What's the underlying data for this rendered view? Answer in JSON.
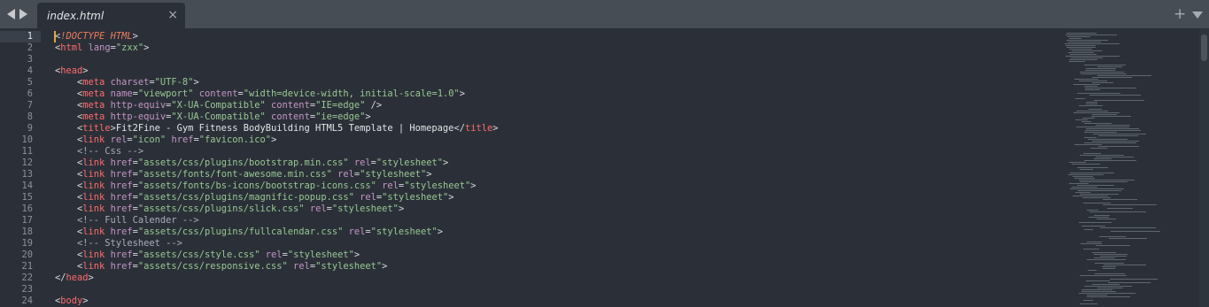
{
  "tabbar": {
    "tab_title": "index.html",
    "close_glyph": "×",
    "plus_glyph": "+"
  },
  "editor": {
    "current_line": 1,
    "lines": [
      {
        "num": "1",
        "tokens": [
          [
            "pn",
            "<"
          ],
          [
            "dt",
            "!DOCTYPE HTML"
          ],
          [
            "pn",
            ">"
          ]
        ]
      },
      {
        "num": "2",
        "tokens": [
          [
            "pn",
            "<"
          ],
          [
            "tg",
            "html"
          ],
          [
            "pn",
            " "
          ],
          [
            "at",
            "lang"
          ],
          [
            "pn",
            "="
          ],
          [
            "st",
            "\"zxx\""
          ],
          [
            "pn",
            ">"
          ]
        ]
      },
      {
        "num": "3",
        "tokens": []
      },
      {
        "num": "4",
        "tokens": [
          [
            "pn",
            "<"
          ],
          [
            "tg",
            "head"
          ],
          [
            "pn",
            ">"
          ]
        ]
      },
      {
        "num": "5",
        "tokens": [
          [
            "pn",
            "    <"
          ],
          [
            "tg",
            "meta"
          ],
          [
            "pn",
            " "
          ],
          [
            "at",
            "charset"
          ],
          [
            "pn",
            "="
          ],
          [
            "st",
            "\"UTF-8\""
          ],
          [
            "pn",
            ">"
          ]
        ]
      },
      {
        "num": "6",
        "tokens": [
          [
            "pn",
            "    <"
          ],
          [
            "tg",
            "meta"
          ],
          [
            "pn",
            " "
          ],
          [
            "at",
            "name"
          ],
          [
            "pn",
            "="
          ],
          [
            "st",
            "\"viewport\""
          ],
          [
            "pn",
            " "
          ],
          [
            "at",
            "content"
          ],
          [
            "pn",
            "="
          ],
          [
            "st",
            "\"width=device-width, initial-scale=1.0\""
          ],
          [
            "pn",
            ">"
          ]
        ]
      },
      {
        "num": "7",
        "tokens": [
          [
            "pn",
            "    <"
          ],
          [
            "tg",
            "meta"
          ],
          [
            "pn",
            " "
          ],
          [
            "at",
            "http-equiv"
          ],
          [
            "pn",
            "="
          ],
          [
            "st",
            "\"X-UA-Compatible\""
          ],
          [
            "pn",
            " "
          ],
          [
            "at",
            "content"
          ],
          [
            "pn",
            "="
          ],
          [
            "st",
            "\"IE=edge\""
          ],
          [
            "pn",
            " />"
          ]
        ]
      },
      {
        "num": "8",
        "tokens": [
          [
            "pn",
            "    <"
          ],
          [
            "tg",
            "meta"
          ],
          [
            "pn",
            " "
          ],
          [
            "at",
            "http-equiv"
          ],
          [
            "pn",
            "="
          ],
          [
            "st",
            "\"X-UA-Compatible\""
          ],
          [
            "pn",
            " "
          ],
          [
            "at",
            "content"
          ],
          [
            "pn",
            "="
          ],
          [
            "st",
            "\"ie=edge\""
          ],
          [
            "pn",
            ">"
          ]
        ]
      },
      {
        "num": "9",
        "tokens": [
          [
            "pn",
            "    <"
          ],
          [
            "tg",
            "title"
          ],
          [
            "pn",
            ">"
          ],
          [
            "tx",
            "Fit2Fine - Gym Fitness BodyBuilding HTML5 Template | Homepage"
          ],
          [
            "pn",
            "</"
          ],
          [
            "tg",
            "title"
          ],
          [
            "pn",
            ">"
          ]
        ]
      },
      {
        "num": "10",
        "tokens": [
          [
            "pn",
            "    <"
          ],
          [
            "tg",
            "link"
          ],
          [
            "pn",
            " "
          ],
          [
            "at",
            "rel"
          ],
          [
            "pn",
            "="
          ],
          [
            "st",
            "\"icon\""
          ],
          [
            "pn",
            " "
          ],
          [
            "at",
            "href"
          ],
          [
            "pn",
            "="
          ],
          [
            "st",
            "\"favicon.ico\""
          ],
          [
            "pn",
            ">"
          ]
        ]
      },
      {
        "num": "11",
        "tokens": [
          [
            "cm",
            "    <!-- Css -->"
          ]
        ]
      },
      {
        "num": "12",
        "tokens": [
          [
            "pn",
            "    <"
          ],
          [
            "tg",
            "link"
          ],
          [
            "pn",
            " "
          ],
          [
            "at",
            "href"
          ],
          [
            "pn",
            "="
          ],
          [
            "st",
            "\"assets/css/plugins/bootstrap.min.css\""
          ],
          [
            "pn",
            " "
          ],
          [
            "at",
            "rel"
          ],
          [
            "pn",
            "="
          ],
          [
            "st",
            "\"stylesheet\""
          ],
          [
            "pn",
            ">"
          ]
        ]
      },
      {
        "num": "13",
        "tokens": [
          [
            "pn",
            "    <"
          ],
          [
            "tg",
            "link"
          ],
          [
            "pn",
            " "
          ],
          [
            "at",
            "href"
          ],
          [
            "pn",
            "="
          ],
          [
            "st",
            "\"assets/fonts/font-awesome.min.css\""
          ],
          [
            "pn",
            " "
          ],
          [
            "at",
            "rel"
          ],
          [
            "pn",
            "="
          ],
          [
            "st",
            "\"stylesheet\""
          ],
          [
            "pn",
            ">"
          ]
        ]
      },
      {
        "num": "14",
        "tokens": [
          [
            "pn",
            "    <"
          ],
          [
            "tg",
            "link"
          ],
          [
            "pn",
            " "
          ],
          [
            "at",
            "href"
          ],
          [
            "pn",
            "="
          ],
          [
            "st",
            "\"assets/fonts/bs-icons/bootstrap-icons.css\""
          ],
          [
            "pn",
            " "
          ],
          [
            "at",
            "rel"
          ],
          [
            "pn",
            "="
          ],
          [
            "st",
            "\"stylesheet\""
          ],
          [
            "pn",
            ">"
          ]
        ]
      },
      {
        "num": "15",
        "tokens": [
          [
            "pn",
            "    <"
          ],
          [
            "tg",
            "link"
          ],
          [
            "pn",
            " "
          ],
          [
            "at",
            "href"
          ],
          [
            "pn",
            "="
          ],
          [
            "st",
            "\"assets/css/plugins/magnific-popup.css\""
          ],
          [
            "pn",
            " "
          ],
          [
            "at",
            "rel"
          ],
          [
            "pn",
            "="
          ],
          [
            "st",
            "\"stylesheet\""
          ],
          [
            "pn",
            ">"
          ]
        ]
      },
      {
        "num": "16",
        "tokens": [
          [
            "pn",
            "    <"
          ],
          [
            "tg",
            "link"
          ],
          [
            "pn",
            " "
          ],
          [
            "at",
            "href"
          ],
          [
            "pn",
            "="
          ],
          [
            "st",
            "\"assets/css/plugins/slick.css\""
          ],
          [
            "pn",
            " "
          ],
          [
            "at",
            "rel"
          ],
          [
            "pn",
            "="
          ],
          [
            "st",
            "\"stylesheet\""
          ],
          [
            "pn",
            ">"
          ]
        ]
      },
      {
        "num": "17",
        "tokens": [
          [
            "cm",
            "    <!-- Full Calender -->"
          ]
        ]
      },
      {
        "num": "18",
        "tokens": [
          [
            "pn",
            "    <"
          ],
          [
            "tg",
            "link"
          ],
          [
            "pn",
            " "
          ],
          [
            "at",
            "href"
          ],
          [
            "pn",
            "="
          ],
          [
            "st",
            "\"assets/css/plugins/fullcalendar.css\""
          ],
          [
            "pn",
            " "
          ],
          [
            "at",
            "rel"
          ],
          [
            "pn",
            "="
          ],
          [
            "st",
            "\"stylesheet\""
          ],
          [
            "pn",
            ">"
          ]
        ]
      },
      {
        "num": "19",
        "tokens": [
          [
            "cm",
            "    <!-- Stylesheet -->"
          ]
        ]
      },
      {
        "num": "20",
        "tokens": [
          [
            "pn",
            "    <"
          ],
          [
            "tg",
            "link"
          ],
          [
            "pn",
            " "
          ],
          [
            "at",
            "href"
          ],
          [
            "pn",
            "="
          ],
          [
            "st",
            "\"assets/css/style.css\""
          ],
          [
            "pn",
            " "
          ],
          [
            "at",
            "rel"
          ],
          [
            "pn",
            "="
          ],
          [
            "st",
            "\"stylesheet\""
          ],
          [
            "pn",
            ">"
          ]
        ]
      },
      {
        "num": "21",
        "tokens": [
          [
            "pn",
            "    <"
          ],
          [
            "tg",
            "link"
          ],
          [
            "pn",
            " "
          ],
          [
            "at",
            "href"
          ],
          [
            "pn",
            "="
          ],
          [
            "st",
            "\"assets/css/responsive.css\""
          ],
          [
            "pn",
            " "
          ],
          [
            "at",
            "rel"
          ],
          [
            "pn",
            "="
          ],
          [
            "st",
            "\"stylesheet\""
          ],
          [
            "pn",
            ">"
          ]
        ]
      },
      {
        "num": "22",
        "tokens": [
          [
            "pn",
            "</"
          ],
          [
            "tg",
            "head"
          ],
          [
            "pn",
            ">"
          ]
        ]
      },
      {
        "num": "23",
        "tokens": []
      },
      {
        "num": "24",
        "tokens": [
          [
            "pn",
            "<"
          ],
          [
            "tg",
            "body"
          ],
          [
            "pn",
            ">"
          ]
        ]
      }
    ]
  },
  "colors": {
    "background": "#2b3038",
    "tab_bar": "#474d54",
    "tag": "#ff6b6b",
    "attribute": "#c594c5",
    "string": "#99c794",
    "comment": "#a7adba",
    "doctype": "#ef7a5d",
    "cursor": "#e8a33c"
  },
  "icons": {
    "nav_back": "triangle-left-icon",
    "nav_forward": "triangle-right-icon",
    "close": "close-icon",
    "new_tab": "plus-icon",
    "tab_menu": "chevron-down-icon"
  }
}
